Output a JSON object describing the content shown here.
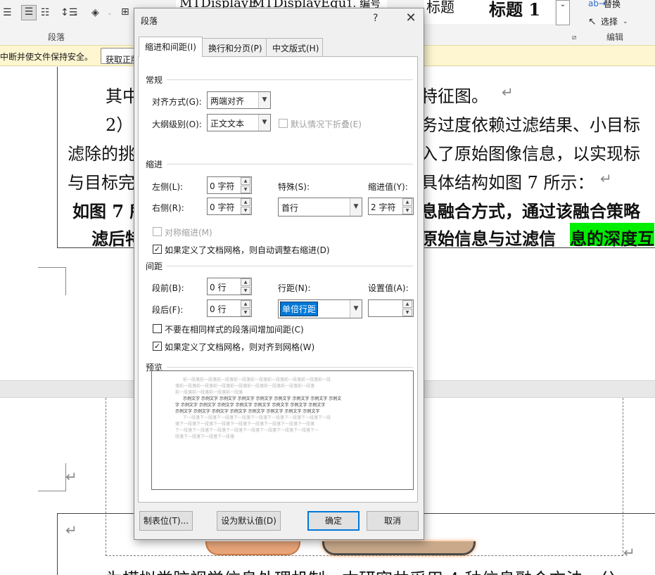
{
  "ribbon": {
    "paragraph_group_label": "段落",
    "edit_group_label": "编辑",
    "replace_label": "替换",
    "select_label": "选择",
    "styles": [
      "MTDisplayE",
      "MTDisplayEqu",
      "1. 编号",
      "标题",
      "标题 1"
    ]
  },
  "notify": {
    "message": "中断并使文件保持安全。",
    "button": "获取正版"
  },
  "document": {
    "lines": [
      "其中",
      "特征图。",
      "2）",
      "务过度依赖过滤结果、小目标",
      "滤除的挑",
      "入了原始图像信息，以实现标",
      "与目标完",
      "具体结构如图 7 所示：",
      "如图 7 所",
      "息融合方式，通过该融合策略",
      "滤后特",
      "原始信息与过滤信",
      "息的深度互",
      "为模拟类脑视觉信息处理机制，本研究共采用 4 种信息融合方法，分"
    ]
  },
  "dialog": {
    "title": "段落",
    "help": "?",
    "close": "✕",
    "tabs": [
      "缩进和间距(I)",
      "换行和分页(P)",
      "中文版式(H)"
    ],
    "general": {
      "section": "常规",
      "alignment_label": "对齐方式(G):",
      "alignment_value": "两端对齐",
      "outline_label": "大纲级别(O):",
      "outline_value": "正文文本",
      "collapse_label": "默认情况下折叠(E)"
    },
    "indent": {
      "section": "缩进",
      "left_label": "左侧(L):",
      "left_value": "0 字符",
      "right_label": "右侧(R):",
      "right_value": "0 字符",
      "special_label": "特殊(S):",
      "special_value": "首行",
      "by_label": "缩进值(Y):",
      "by_value": "2 字符",
      "mirror_label": "对称缩进(M)",
      "auto_adjust_label": "如果定义了文档网格，则自动调整右缩进(D)"
    },
    "spacing": {
      "section": "间距",
      "before_label": "段前(B):",
      "before_value": "0 行",
      "after_label": "段后(F):",
      "after_value": "0 行",
      "line_label": "行距(N):",
      "line_value": "单倍行距",
      "at_label": "设置值(A):",
      "at_value": "",
      "no_space_label": "不要在相同样式的段落间增加间距(C)",
      "snap_grid_label": "如果定义了文档网格，则对齐到网格(W)"
    },
    "preview": {
      "section": "预览",
      "prev_lines": [
        "前一段落前一段落前一段落前一段落前一段落前一段落前一段落前一段落前一段",
        "落前一段落前一段落前一段落前一段落前一段落前一段落前一段落前一段落",
        "前一段落前一段落前一段落前一段落"
      ],
      "sample_lines": [
        "示例文字 示例文字 示例文字 示例文字 示例文字 示例文字 示例文字 示例文字 示例文",
        "字 示例文字 示例文字 示例文字 示例文字 示例文字 示例文字 示例文字 示例文字",
        "示例文字 示例文字 示例文字 示例文字 示例文字 示例文字 示例文字 示例文字"
      ],
      "next_lines": [
        "下一段落下一段落下一段落下一段落下一段落下一段落下一段落下一段落下一段",
        "落下一段落下一段落下一段落下一段落下一段落下一段落下一段落下一段落",
        "下一段落下一段落下一段落下一段落下一段落下一段落下一段落下一段落下一",
        "段落下一段落下一段落下一段落"
      ]
    },
    "buttons": {
      "tabs_button": "制表位(T)...",
      "default_button": "设为默认值(D)",
      "ok_button": "确定",
      "cancel_button": "取消"
    }
  },
  "colors": {
    "highlight": "#00ee00",
    "selection": "#0078d7",
    "notify_bg": "#fdf6d0"
  }
}
